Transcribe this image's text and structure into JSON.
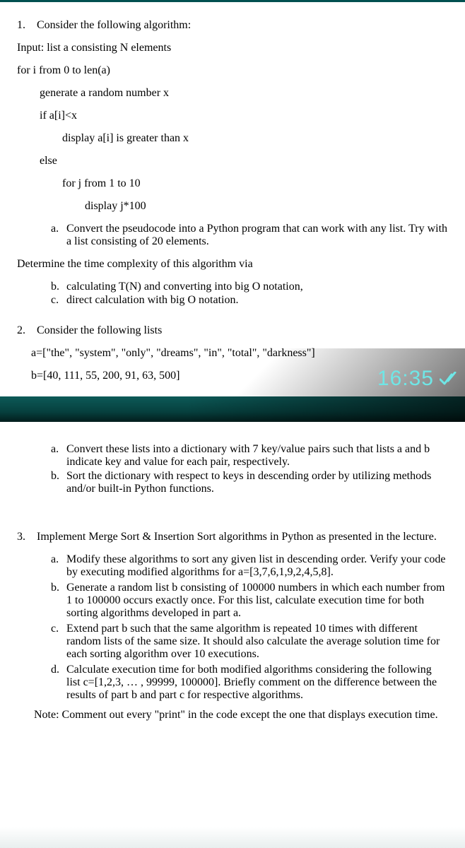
{
  "q1": {
    "num": "1.",
    "title": "Consider the following algorithm:",
    "input_line": "Input: list a consisting N elements",
    "for_line": "for i from 0 to len(a)",
    "gen_line": "generate a random number x",
    "if_line": "if a[i]<x",
    "display1": "display a[i] is greater than x",
    "else_line": "else",
    "forj_line": "for j from 1 to 10",
    "display2": "display j*100",
    "a": {
      "lbl": "a.",
      "txt": "Convert the pseudocode into a Python program that can work with any list. Try with a list consisting of 20 elements."
    },
    "determine": "Determine the time complexity of this algorithm via",
    "b": {
      "lbl": "b.",
      "txt": "calculating T(N) and converting into big O notation,"
    },
    "c": {
      "lbl": "c.",
      "txt": "direct calculation with big O notation."
    }
  },
  "q2": {
    "num": "2.",
    "title": "Consider the following lists",
    "list_a": "a=[\"the\", \"system\", \"only\", \"dreams\", \"in\", \"total\", \"darkness\"]",
    "list_b": "b=[40, 111, 55, 200, 91, 63, 500]",
    "a": {
      "lbl": "a.",
      "txt": "Convert these lists into a dictionary with 7 key/value pairs such that lists a and b indicate key and value for each pair, respectively."
    },
    "b": {
      "lbl": "b.",
      "txt": "Sort the dictionary with respect to keys in descending order by utilizing methods and/or built-in Python functions."
    }
  },
  "clock": "16:35",
  "q3": {
    "num": "3.",
    "title": "Implement Merge Sort & Insertion Sort algorithms in Python as presented in the lecture.",
    "a": {
      "lbl": "a.",
      "txt": "Modify these algorithms to sort any given list in descending order. Verify your code by executing modified algorithms for a=[3,7,6,1,9,2,4,5,8]."
    },
    "b": {
      "lbl": "b.",
      "txt": "Generate a random list b consisting of 100000 numbers in which each number from 1 to 100000 occurs exactly once. For this list, calculate execution time for both sorting algorithms developed in part a."
    },
    "c": {
      "lbl": "c.",
      "txt": "Extend part b such that the same algorithm is repeated 10 times with different random lists of the same size. It should also calculate the average solution time for each sorting algorithm over 10 executions."
    },
    "d": {
      "lbl": "d.",
      "txt": "Calculate execution time for both modified algorithms considering the following list c=[1,2,3, … , 99999, 100000]. Briefly comment on the difference between the results of part b and part c for respective algorithms."
    },
    "note": "Note: Comment out every \"print\" in the code except the one that displays execution time."
  }
}
